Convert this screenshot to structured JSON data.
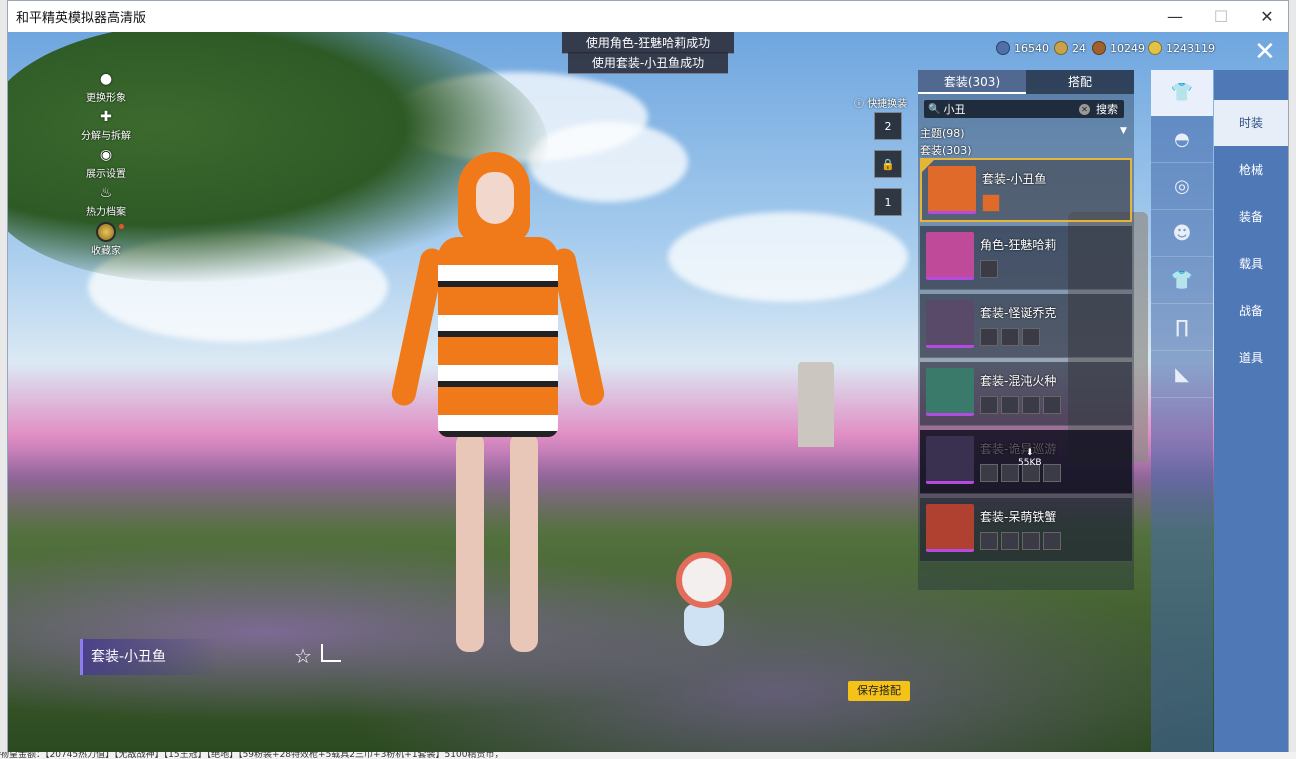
{
  "window": {
    "title": "和平精英模拟器高清版",
    "minimize": "—",
    "maximize": "☐",
    "close": "✕"
  },
  "left_menu": {
    "items": [
      {
        "label": "更换形象",
        "icon": "person-icon"
      },
      {
        "label": "分解与拆解",
        "icon": "puzzle-icon"
      },
      {
        "label": "展示设置",
        "icon": "eye-icon"
      },
      {
        "label": "热力档案",
        "icon": "flame-icon"
      },
      {
        "label": "收藏家",
        "icon": "medal-icon"
      }
    ]
  },
  "toasts": [
    "使用角色-狂魅哈莉成功",
    "使用套装-小丑鱼成功"
  ],
  "currency": [
    {
      "icon": "globe-coin-icon",
      "value": "16540",
      "color": "#4f6fa8"
    },
    {
      "icon": "badge-coin-icon",
      "value": "24",
      "color": "#c9a24a"
    },
    {
      "icon": "bronze-coin-icon",
      "value": "10249",
      "color": "#a0622a"
    },
    {
      "icon": "gold-coin-icon",
      "value": "1243119",
      "color": "#e3c24a"
    }
  ],
  "quick_swap": {
    "label": "快捷换装",
    "buttons": [
      "2",
      "",
      "1"
    ]
  },
  "panel": {
    "tabs": [
      {
        "label": "套装(303)",
        "active": true
      },
      {
        "label": "搭配",
        "active": false
      }
    ],
    "search": {
      "value": "小丑",
      "clear": "✕",
      "button": "搜索"
    },
    "filters": [
      "主题(98)",
      "套装(303)"
    ],
    "items": [
      {
        "name": "套装-小丑鱼",
        "selected": true,
        "dim": false,
        "thumb_color": "#e06a2a",
        "subs": 1
      },
      {
        "name": "角色-狂魅哈莉",
        "selected": false,
        "dim": false,
        "thumb_color": "#c04a9a",
        "subs": 1
      },
      {
        "name": "套装-怪诞乔克",
        "selected": false,
        "dim": false,
        "thumb_color": "#5a4a6a",
        "subs": 3
      },
      {
        "name": "套装-混沌火种",
        "selected": false,
        "dim": false,
        "thumb_color": "#3a7a6a",
        "subs": 4
      },
      {
        "name": "套装-诡异巡游",
        "selected": false,
        "dim": true,
        "thumb_color": "#3a3050",
        "subs": 4,
        "download": "55KB"
      },
      {
        "name": "套装-呆萌铁蟹",
        "selected": false,
        "dim": false,
        "thumb_color": "#b04030",
        "subs": 4
      }
    ]
  },
  "categories": [
    {
      "icon": "outfit-icon",
      "active": true
    },
    {
      "icon": "cap-icon",
      "active": false
    },
    {
      "icon": "goggles-icon",
      "active": false
    },
    {
      "icon": "mask-icon",
      "active": false
    },
    {
      "icon": "jacket-icon",
      "active": false
    },
    {
      "icon": "pants-icon",
      "active": false
    },
    {
      "icon": "shoes-icon",
      "active": false
    }
  ],
  "vertical_tabs": [
    {
      "label": "时装",
      "active": true
    },
    {
      "label": "枪械",
      "active": false
    },
    {
      "label": "装备",
      "active": false
    },
    {
      "label": "载具",
      "active": false
    },
    {
      "label": "战备",
      "active": false
    },
    {
      "label": "道具",
      "active": false
    }
  ],
  "outfit_name": "套装-小丑鱼",
  "save_button": "保存搭配",
  "bottom_text": "物皇金额：【20745热力值】【无敌战神】【15王冠】【绝地】【59粉装+28特效枪+5载具2三巾+3粉机+1套装】5100精贵币，"
}
